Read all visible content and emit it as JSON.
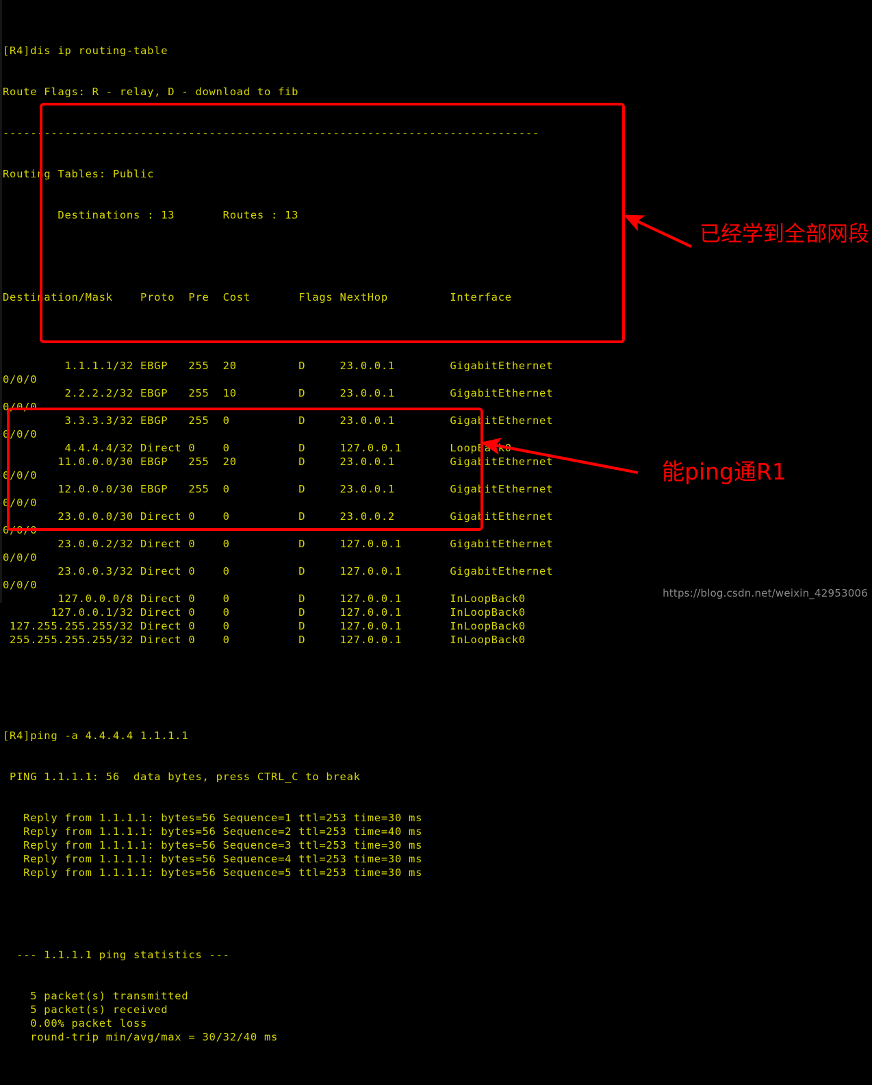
{
  "terminal": {
    "prompt_command": "[R4]dis ip routing-table",
    "route_flags": "Route Flags: R - relay, D - download to fib",
    "separator": "------------------------------------------------------------------------------",
    "routing_tables_label": "Routing Tables: Public",
    "summary": "        Destinations : 13       Routes : 13",
    "destinations_count": "13",
    "routes_count": "13",
    "columns": [
      "Destination/Mask",
      "Proto",
      "Pre",
      "Cost",
      "Flags",
      "NextHop",
      "Interface"
    ],
    "header_line": "Destination/Mask    Proto  Pre  Cost       Flags NextHop         Interface",
    "routes": [
      {
        "dest": "1.1.1.1/32",
        "proto": "EBGP",
        "pre": "255",
        "cost": "20",
        "flags": "D",
        "nexthop": "23.0.0.1",
        "interface": "GigabitEthernet",
        "wrap": "0/0/0"
      },
      {
        "dest": "2.2.2.2/32",
        "proto": "EBGP",
        "pre": "255",
        "cost": "10",
        "flags": "D",
        "nexthop": "23.0.0.1",
        "interface": "GigabitEthernet",
        "wrap": "0/0/0"
      },
      {
        "dest": "3.3.3.3/32",
        "proto": "EBGP",
        "pre": "255",
        "cost": "0",
        "flags": "D",
        "nexthop": "23.0.0.1",
        "interface": "GigabitEthernet",
        "wrap": "0/0/0"
      },
      {
        "dest": "4.4.4.4/32",
        "proto": "Direct",
        "pre": "0",
        "cost": "0",
        "flags": "D",
        "nexthop": "127.0.0.1",
        "interface": "LoopBack0",
        "wrap": ""
      },
      {
        "dest": "11.0.0.0/30",
        "proto": "EBGP",
        "pre": "255",
        "cost": "20",
        "flags": "D",
        "nexthop": "23.0.0.1",
        "interface": "GigabitEthernet",
        "wrap": "0/0/0"
      },
      {
        "dest": "12.0.0.0/30",
        "proto": "EBGP",
        "pre": "255",
        "cost": "0",
        "flags": "D",
        "nexthop": "23.0.0.1",
        "interface": "GigabitEthernet",
        "wrap": "0/0/0"
      },
      {
        "dest": "23.0.0.0/30",
        "proto": "Direct",
        "pre": "0",
        "cost": "0",
        "flags": "D",
        "nexthop": "23.0.0.2",
        "interface": "GigabitEthernet",
        "wrap": "0/0/0"
      },
      {
        "dest": "23.0.0.2/32",
        "proto": "Direct",
        "pre": "0",
        "cost": "0",
        "flags": "D",
        "nexthop": "127.0.0.1",
        "interface": "GigabitEthernet",
        "wrap": "0/0/0"
      },
      {
        "dest": "23.0.0.3/32",
        "proto": "Direct",
        "pre": "0",
        "cost": "0",
        "flags": "D",
        "nexthop": "127.0.0.1",
        "interface": "GigabitEthernet",
        "wrap": "0/0/0"
      },
      {
        "dest": "127.0.0.0/8",
        "proto": "Direct",
        "pre": "0",
        "cost": "0",
        "flags": "D",
        "nexthop": "127.0.0.1",
        "interface": "InLoopBack0",
        "wrap": ""
      },
      {
        "dest": "127.0.0.1/32",
        "proto": "Direct",
        "pre": "0",
        "cost": "0",
        "flags": "D",
        "nexthop": "127.0.0.1",
        "interface": "InLoopBack0",
        "wrap": ""
      },
      {
        "dest": "127.255.255.255/32",
        "proto": "Direct",
        "pre": "0",
        "cost": "0",
        "flags": "D",
        "nexthop": "127.0.0.1",
        "interface": "InLoopBack0",
        "wrap": ""
      },
      {
        "dest": "255.255.255.255/32",
        "proto": "Direct",
        "pre": "0",
        "cost": "0",
        "flags": "D",
        "nexthop": "127.0.0.1",
        "interface": "InLoopBack0",
        "wrap": ""
      }
    ],
    "ping": {
      "command": "[R4]ping -a 4.4.4.4 1.1.1.1",
      "banner": " PING 1.1.1.1: 56  data bytes, press CTRL_C to break",
      "replies": [
        "   Reply from 1.1.1.1: bytes=56 Sequence=1 ttl=253 time=30 ms",
        "   Reply from 1.1.1.1: bytes=56 Sequence=2 ttl=253 time=40 ms",
        "   Reply from 1.1.1.1: bytes=56 Sequence=3 ttl=253 time=30 ms",
        "   Reply from 1.1.1.1: bytes=56 Sequence=4 ttl=253 time=30 ms",
        "   Reply from 1.1.1.1: bytes=56 Sequence=5 ttl=253 time=30 ms"
      ],
      "stats_header": "  --- 1.1.1.1 ping statistics ---",
      "stats": [
        "    5 packet(s) transmitted",
        "    5 packet(s) received",
        "    0.00% packet loss",
        "    round-trip min/avg/max = 30/32/40 ms"
      ],
      "transmitted": "5",
      "received": "5",
      "packet_loss": "0.00%",
      "round_trip": "30/32/40 ms"
    }
  },
  "annotations": {
    "routes_note": "已经学到全部网段",
    "ping_note": "能ping通R1",
    "color": "#ff0000"
  },
  "watermark": {
    "text": "https://blog.csdn.net/weixin_42953006"
  },
  "theme": {
    "background": "#000000",
    "text_color": "#d6d600",
    "annotation_color": "#ff0000",
    "watermark_color": "#8a8a8a"
  }
}
